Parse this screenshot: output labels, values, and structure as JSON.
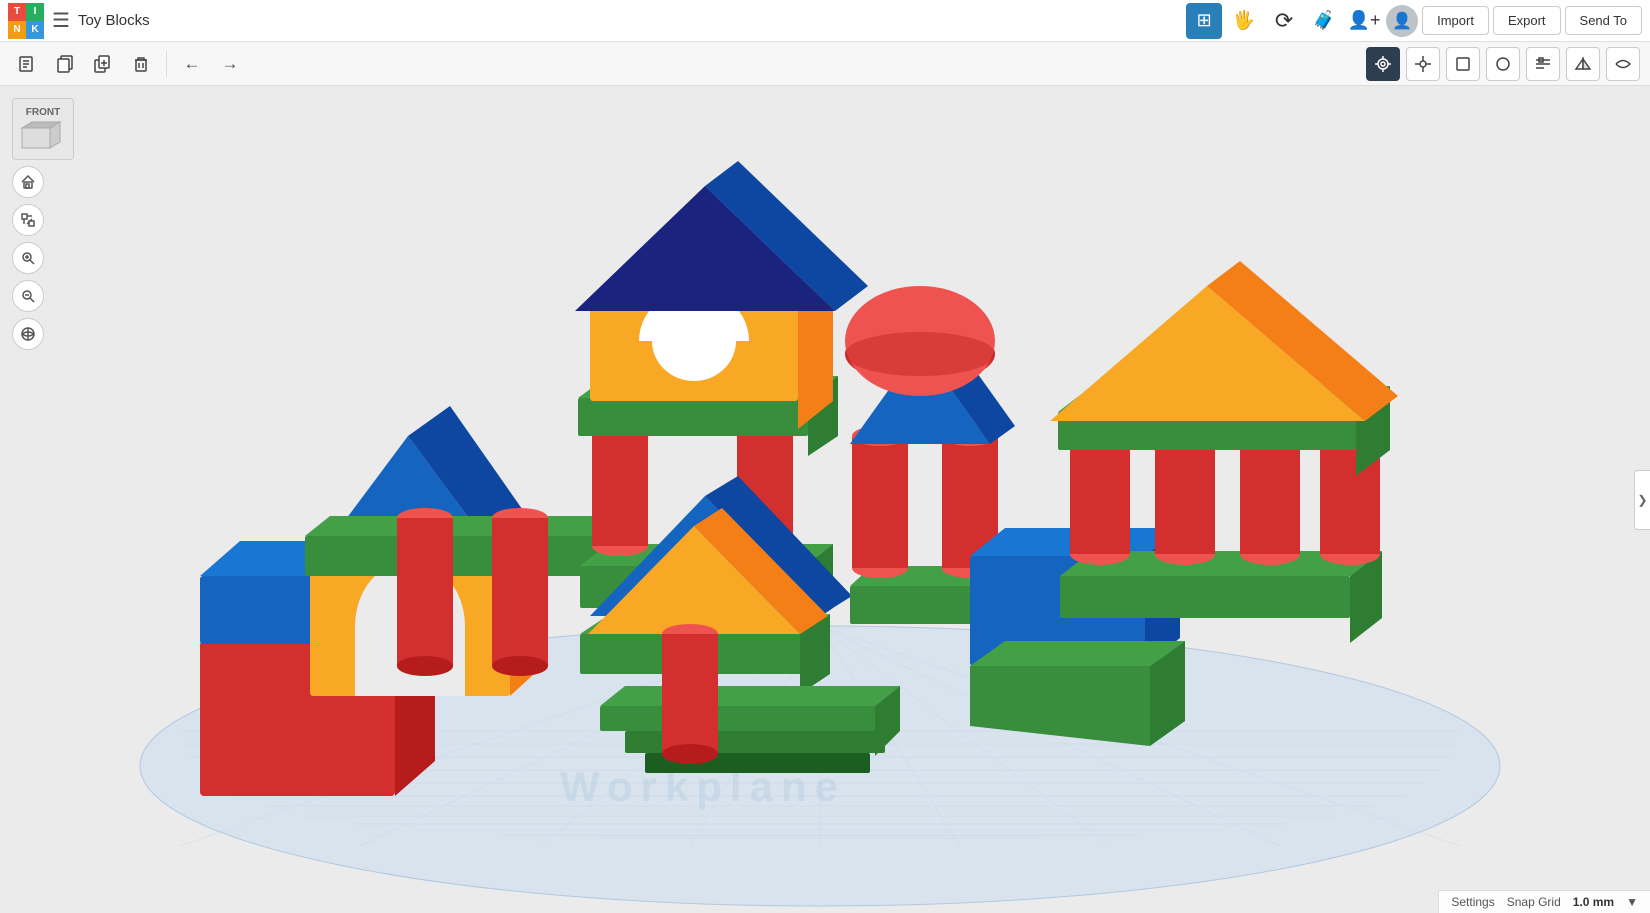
{
  "app": {
    "logo": {
      "t": "T",
      "i": "I",
      "n": "N",
      "k": "K"
    },
    "title": "Toy Blocks"
  },
  "topbar": {
    "doc_icon": "☰",
    "icons": [
      {
        "id": "grid-icon",
        "symbol": "⊞",
        "active": true,
        "label": "grid view"
      },
      {
        "id": "person-icon",
        "symbol": "🖐",
        "active": false,
        "label": "hand tool"
      },
      {
        "id": "rotate-icon",
        "symbol": "⟳",
        "active": false,
        "label": "rotate"
      },
      {
        "id": "briefcase-icon",
        "symbol": "💼",
        "active": false,
        "label": "briefcase"
      },
      {
        "id": "profile-icon",
        "symbol": "👤",
        "active": false,
        "label": "profile"
      },
      {
        "id": "avatar-icon",
        "symbol": "👤",
        "active": false,
        "label": "avatar"
      }
    ],
    "actions": [
      "Import",
      "Export",
      "Send To"
    ]
  },
  "toolbar": {
    "left_tools": [
      {
        "id": "new-doc",
        "symbol": "📄",
        "label": "new document"
      },
      {
        "id": "copy-doc",
        "symbol": "📋",
        "label": "copy"
      },
      {
        "id": "duplicate",
        "symbol": "⧉",
        "label": "duplicate"
      },
      {
        "id": "delete",
        "symbol": "🗑",
        "label": "delete"
      },
      {
        "id": "undo",
        "symbol": "↩",
        "label": "undo"
      },
      {
        "id": "redo",
        "symbol": "↪",
        "label": "redo"
      }
    ],
    "right_tools": [
      {
        "id": "camera-tool",
        "symbol": "◎",
        "label": "camera",
        "active": true
      },
      {
        "id": "point-tool",
        "symbol": "◦",
        "label": "point"
      },
      {
        "id": "shape-tool",
        "symbol": "◻",
        "label": "shape"
      },
      {
        "id": "circle-tool",
        "symbol": "○",
        "label": "circle"
      },
      {
        "id": "align-tool",
        "symbol": "⊟",
        "label": "align"
      },
      {
        "id": "mirror-tool",
        "symbol": "△",
        "label": "mirror"
      },
      {
        "id": "group-tool",
        "symbol": "∿",
        "label": "group"
      }
    ]
  },
  "viewport": {
    "view_label": "FRONT",
    "workplane_watermark": "Workplane",
    "snap_grid_label": "Snap Grid",
    "snap_grid_value": "1.0 mm",
    "settings_label": "Settings"
  },
  "left_controls": [
    {
      "id": "home-btn",
      "symbol": "⌂",
      "label": "home view"
    },
    {
      "id": "fit-btn",
      "symbol": "⊕",
      "label": "fit to view"
    },
    {
      "id": "zoom-in-btn",
      "symbol": "+",
      "label": "zoom in"
    },
    {
      "id": "zoom-out-btn",
      "symbol": "−",
      "label": "zoom out"
    },
    {
      "id": "perspective-btn",
      "symbol": "⟲",
      "label": "perspective"
    }
  ],
  "right_handle": {
    "symbol": "❯",
    "label": "collapse panel"
  }
}
